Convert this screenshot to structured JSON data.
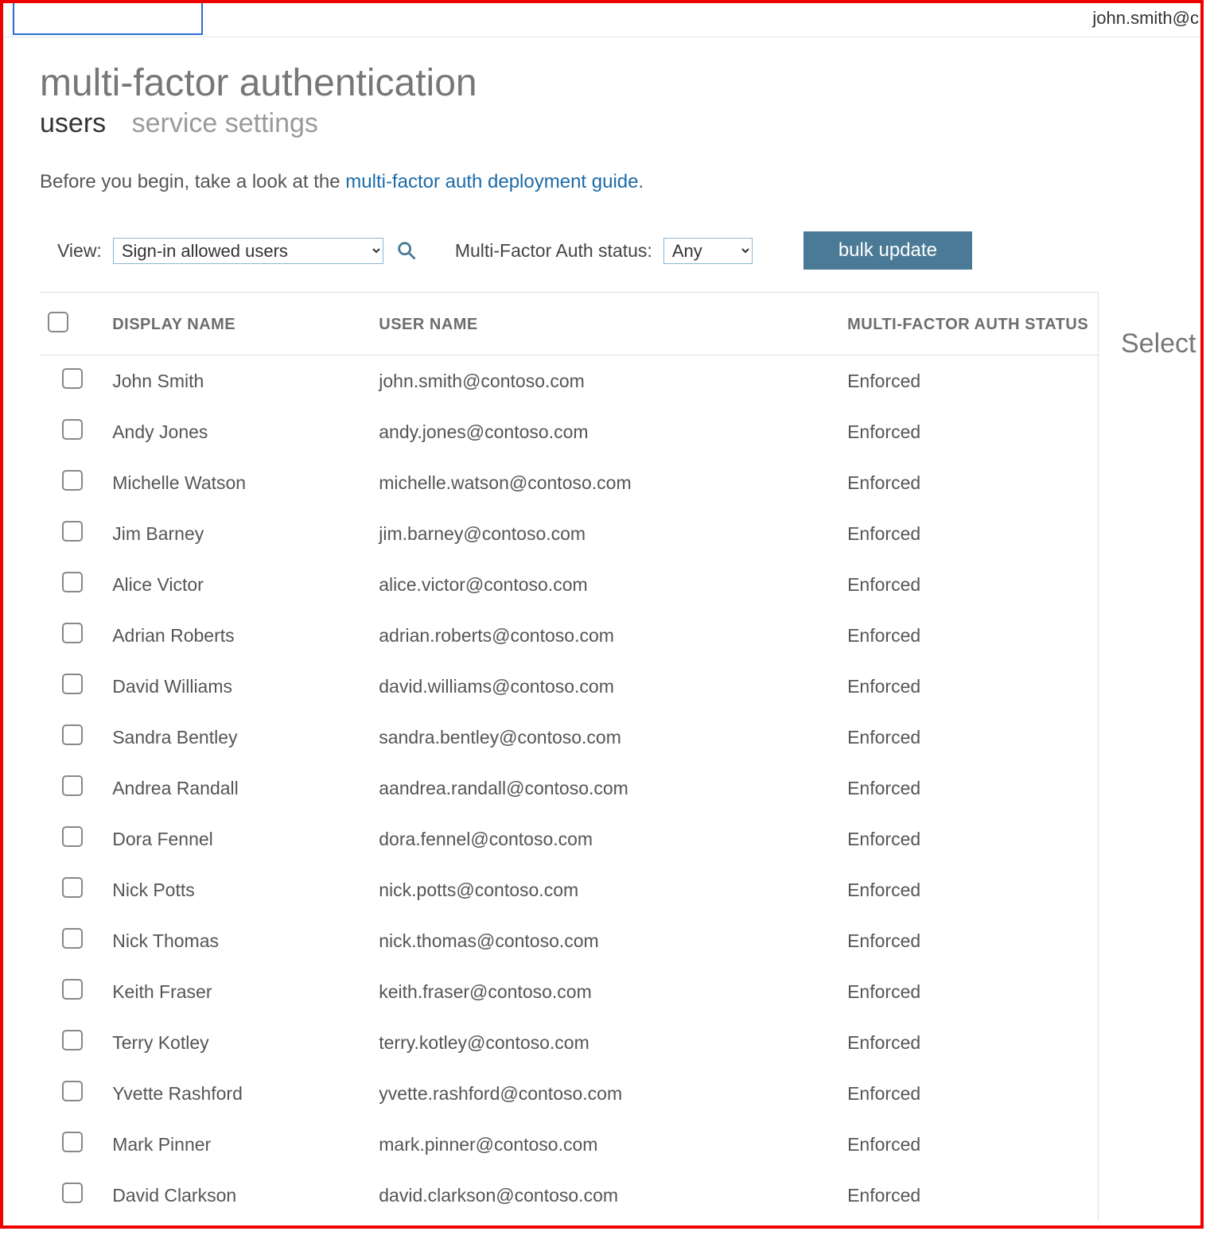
{
  "header": {
    "account_text": "john.smith@c"
  },
  "page": {
    "title": "multi-factor authentication",
    "tabs": [
      {
        "label": "users",
        "active": true
      },
      {
        "label": "service settings",
        "active": false
      }
    ],
    "intro_prefix": "Before you begin, take a look at the ",
    "intro_link": "multi-factor auth deployment guide",
    "intro_suffix": "."
  },
  "toolbar": {
    "view_label": "View:",
    "view_value": "Sign-in allowed users",
    "status_label": "Multi-Factor Auth status:",
    "status_value": "Any",
    "bulk_label": "bulk update"
  },
  "columns": {
    "display_name": "DISPLAY NAME",
    "user_name": "USER NAME",
    "mfa_status": "MULTI-FACTOR AUTH STATUS"
  },
  "side_panel": {
    "heading": "Select"
  },
  "users": [
    {
      "display": "John Smith",
      "user": "john.smith@contoso.com",
      "status": "Enforced"
    },
    {
      "display": "Andy Jones",
      "user": "andy.jones@contoso.com",
      "status": "Enforced"
    },
    {
      "display": "Michelle Watson",
      "user": "michelle.watson@contoso.com",
      "status": "Enforced"
    },
    {
      "display": "Jim Barney",
      "user": "jim.barney@contoso.com",
      "status": "Enforced"
    },
    {
      "display": "Alice Victor",
      "user": "alice.victor@contoso.com",
      "status": "Enforced"
    },
    {
      "display": "Adrian Roberts",
      "user": "adrian.roberts@contoso.com",
      "status": "Enforced"
    },
    {
      "display": "David Williams",
      "user": "david.williams@contoso.com",
      "status": "Enforced"
    },
    {
      "display": "Sandra Bentley",
      "user": "sandra.bentley@contoso.com",
      "status": "Enforced"
    },
    {
      "display": "Andrea Randall",
      "user": "aandrea.randall@contoso.com",
      "status": "Enforced"
    },
    {
      "display": "Dora Fennel",
      "user": "dora.fennel@contoso.com",
      "status": "Enforced"
    },
    {
      "display": "Nick Potts",
      "user": "nick.potts@contoso.com",
      "status": "Enforced"
    },
    {
      "display": "Nick Thomas",
      "user": "nick.thomas@contoso.com",
      "status": "Enforced"
    },
    {
      "display": "Keith Fraser",
      "user": "keith.fraser@contoso.com",
      "status": "Enforced"
    },
    {
      "display": "Terry Kotley",
      "user": "terry.kotley@contoso.com",
      "status": "Enforced"
    },
    {
      "display": "Yvette Rashford",
      "user": "yvette.rashford@contoso.com",
      "status": "Enforced"
    },
    {
      "display": "Mark Pinner",
      "user": "mark.pinner@contoso.com",
      "status": "Enforced"
    },
    {
      "display": "David Clarkson",
      "user": "david.clarkson@contoso.com",
      "status": "Enforced"
    }
  ]
}
